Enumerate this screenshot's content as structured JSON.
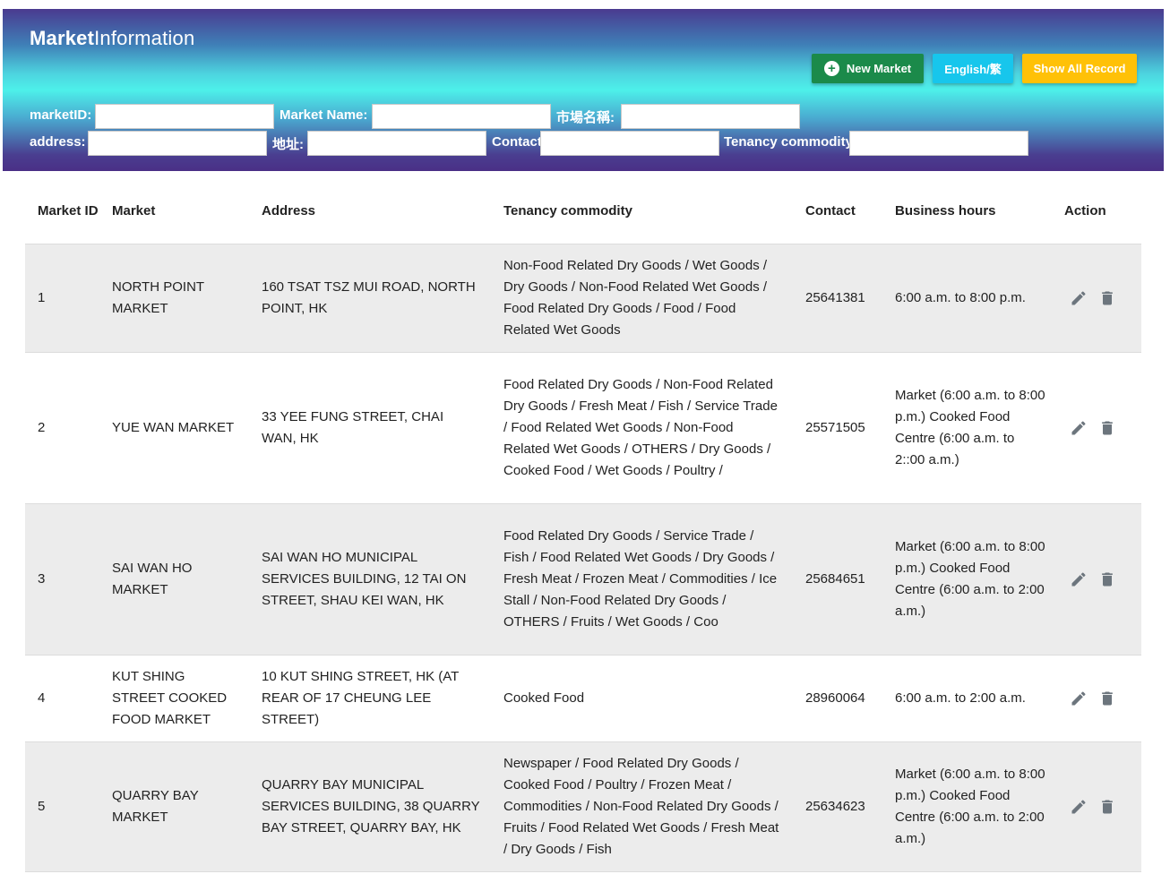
{
  "brand": {
    "bold": "Market",
    "rest": "Information"
  },
  "buttons": {
    "new_market": "New Market",
    "language": "English/繁",
    "show_all": "Show All Record"
  },
  "filters": {
    "market_id": {
      "label": "marketID:",
      "value": ""
    },
    "market_name": {
      "label": "Market Name:",
      "value": ""
    },
    "market_name_zh": {
      "label": "市場名稱:",
      "value": ""
    },
    "address": {
      "label": "address:",
      "value": ""
    },
    "address_zh": {
      "label": "地址:",
      "value": ""
    },
    "contact": {
      "label": "Contact",
      "value": ""
    },
    "tenancy": {
      "label": "Tenancy commodity",
      "value": ""
    }
  },
  "table": {
    "headers": {
      "id": "Market ID",
      "market": "Market",
      "address": "Address",
      "tenancy": "Tenancy commodity",
      "contact": "Contact",
      "hours": "Business hours",
      "action": "Action"
    },
    "rows": [
      {
        "id": "1",
        "market": "NORTH POINT MARKET",
        "address": "160 TSAT TSZ MUI ROAD, NORTH POINT, HK",
        "tenancy": "Non-Food Related Dry Goods / Wet Goods / Dry Goods / Non-Food Related Wet Goods / Food Related Dry Goods / Food / Food Related Wet Goods",
        "contact": "25641381",
        "hours": "6:00 a.m. to 8:00 p.m."
      },
      {
        "id": "2",
        "market": "YUE WAN MARKET",
        "address": "33 YEE FUNG STREET, CHAI WAN, HK",
        "tenancy": "Food Related Dry Goods / Non-Food Related Dry Goods / Fresh Meat / Fish / Service Trade / Food Related Wet Goods / Non-Food Related Wet Goods / OTHERS / Dry Goods / Cooked Food / Wet Goods / Poultry /",
        "contact": "25571505",
        "hours": "Market (6:00 a.m. to 8:00 p.m.) Cooked Food Centre (6:00 a.m. to 2::00 a.m.)"
      },
      {
        "id": "3",
        "market": "SAI WAN HO MARKET",
        "address": "SAI WAN HO MUNICIPAL SERVICES BUILDING, 12 TAI ON STREET, SHAU KEI WAN, HK",
        "tenancy": "Food Related Dry Goods / Service Trade / Fish / Food Related Wet Goods / Dry Goods / Fresh Meat / Frozen Meat / Commodities / Ice Stall / Non-Food Related Dry Goods / OTHERS / Fruits / Wet Goods / Coo",
        "contact": "25684651",
        "hours": "Market (6:00 a.m. to 8:00 p.m.) Cooked Food Centre (6:00 a.m. to 2:00 a.m.)"
      },
      {
        "id": "4",
        "market": "KUT SHING STREET COOKED FOOD MARKET",
        "address": "10 KUT SHING STREET, HK (AT REAR OF 17 CHEUNG LEE STREET)",
        "tenancy": "Cooked Food",
        "contact": "28960064",
        "hours": "6:00 a.m. to 2:00 a.m."
      },
      {
        "id": "5",
        "market": "QUARRY BAY MARKET",
        "address": "QUARRY BAY MUNICIPAL SERVICES BUILDING, 38 QUARRY BAY STREET, QUARRY BAY, HK",
        "tenancy": "Newspaper / Food Related Dry Goods / Cooked Food / Poultry / Frozen Meat / Commodities / Non-Food Related Dry Goods / Fruits / Food Related Wet Goods / Fresh Meat / Dry Goods / Fish",
        "contact": "25634623",
        "hours": "Market (6:00 a.m. to 8:00 p.m.) Cooked Food Centre (6:00 a.m. to 2:00 a.m.)"
      }
    ]
  },
  "colors": {
    "primary_green": "#1b8a4a",
    "info_cyan": "#17c6ec",
    "warning_yellow": "#ffc107",
    "icon_gray": "#6c757d"
  },
  "icons": {
    "new": "plus-circle-icon",
    "edit": "pencil-icon",
    "delete": "trash-icon"
  }
}
